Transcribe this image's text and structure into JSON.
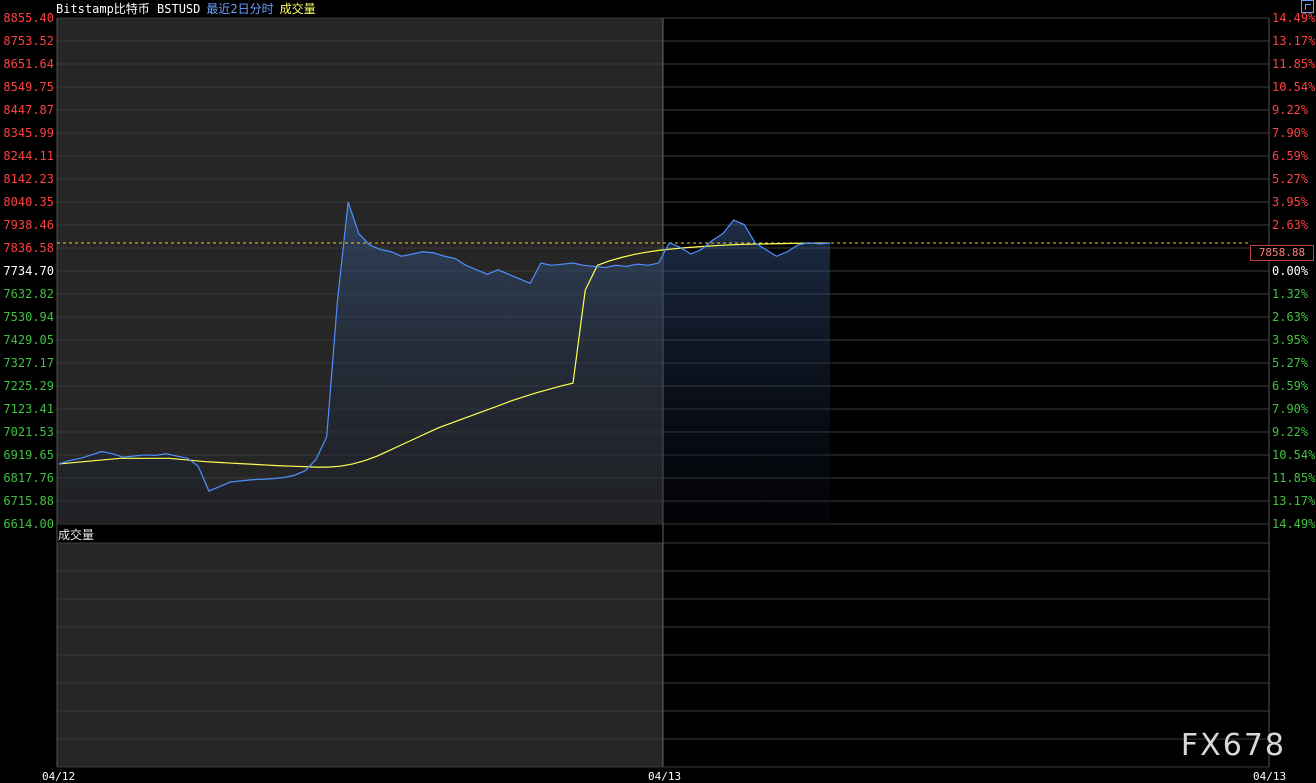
{
  "header": {
    "instrument": "Bitstamp比特币 BSTUSD",
    "period": "最近2日分时",
    "indicator": "成交量"
  },
  "colors": {
    "price_line": "#4f8fff",
    "avg_line": "#ffff55",
    "axis_up": "#ff4040",
    "axis_down": "#40c040",
    "axis_base": "#ffffff",
    "last_price": "#ffcc00"
  },
  "volume_panel": {
    "title": "成交量"
  },
  "last_price_tag": "7858.88",
  "watermark": "FX678",
  "dates": [
    "04/12",
    "04/13",
    "04/13"
  ],
  "chart_data": {
    "type": "line",
    "title": "",
    "ylim": [
      6614.0,
      8855.4
    ],
    "base_price": 7734.7,
    "left_ticks": [
      "8855.40",
      "8753.52",
      "8651.64",
      "8549.75",
      "8447.87",
      "8345.99",
      "8244.11",
      "8142.23",
      "8040.35",
      "7938.46",
      "7836.58",
      "7734.70",
      "7632.82",
      "7530.94",
      "7429.05",
      "7327.17",
      "7225.29",
      "7123.41",
      "7021.53",
      "6919.65",
      "6817.76",
      "6715.88",
      "6614.00"
    ],
    "right_ticks": [
      "14.49%",
      "13.17%",
      "11.85%",
      "10.54%",
      "9.22%",
      "7.90%",
      "6.59%",
      "5.27%",
      "3.95%",
      "2.63%",
      "",
      "0.00%",
      "1.32%",
      "2.63%",
      "3.95%",
      "5.27%",
      "6.59%",
      "7.90%",
      "9.22%",
      "10.54%",
      "11.85%",
      "13.17%",
      "14.49%"
    ],
    "x_sessions": [
      "04/12",
      "04/13"
    ],
    "series": [
      {
        "name": "",
        "values": [
          6880,
          6895,
          6905,
          6920,
          6935,
          6925,
          6910,
          6915,
          6920,
          6918,
          6925,
          6915,
          6905,
          6870,
          6760,
          6780,
          6800,
          6805,
          6810,
          6812,
          6815,
          6820,
          6830,
          6850,
          6900,
          7000,
          7600,
          8040,
          7900,
          7850,
          7830,
          7820,
          7800,
          7810,
          7820,
          7815,
          7800,
          7790,
          7760,
          7740,
          7720,
          7740,
          7720,
          7700,
          7680,
          7770,
          7760,
          7765,
          7770,
          7760,
          7755,
          7750,
          7760,
          7755,
          7765,
          7760,
          7770,
          7860,
          7840,
          7810,
          7830,
          7870,
          7900,
          7960,
          7940,
          7860,
          7830,
          7800,
          7820,
          7850,
          7860,
          7855,
          7858.88
        ]
      },
      {
        "name": "",
        "values": [
          6880,
          6885,
          6890,
          6895,
          6900,
          6905,
          6905,
          6905,
          6905,
          6905,
          6900,
          6895,
          6890,
          6887,
          6884,
          6881,
          6878,
          6875,
          6872,
          6870,
          6868,
          6866,
          6866,
          6870,
          6880,
          6895,
          6915,
          6940,
          6965,
          6990,
          7015,
          7040,
          7060,
          7080,
          7100,
          7120,
          7140,
          7160,
          7178,
          7195,
          7210,
          7225,
          7238,
          7650,
          7760,
          7780,
          7795,
          7808,
          7818,
          7826,
          7832,
          7837,
          7841,
          7845,
          7848,
          7851,
          7853,
          7854,
          7855,
          7856,
          7857,
          7858,
          7858.5,
          7858.8
        ]
      }
    ]
  }
}
